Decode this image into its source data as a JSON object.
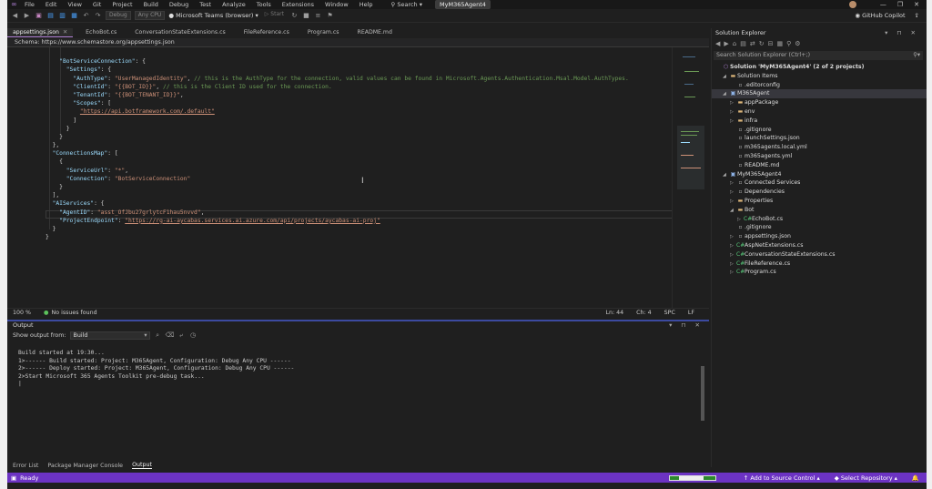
{
  "menu": {
    "items": [
      "File",
      "Edit",
      "View",
      "Git",
      "Project",
      "Build",
      "Debug",
      "Test",
      "Analyze",
      "Tools",
      "Extensions",
      "Window",
      "Help"
    ],
    "search": "Search",
    "solution_name": "MyM365Agent4"
  },
  "toolbar": {
    "config": "Debug",
    "platform": "Any CPU",
    "run_target": "Microsoft Teams (browser)",
    "start": "Start",
    "copilot": "GitHub Copilot"
  },
  "tabs": [
    {
      "label": "appsettings.json",
      "active": true
    },
    {
      "label": "EchoBot.cs",
      "active": false
    },
    {
      "label": "ConversationStateExtensions.cs",
      "active": false
    },
    {
      "label": "FileReference.cs",
      "active": false
    },
    {
      "label": "Program.cs",
      "active": false
    },
    {
      "label": "README.md",
      "active": false
    }
  ],
  "schema": "Schema: https://www.schemastore.org/appsettings.json",
  "code": {
    "l1_key": "\"BotServiceConnection\"",
    "l2_key": "\"Settings\"",
    "l3_key": "\"AuthType\"",
    "l3_val": "\"UserManagedIdentity\"",
    "l3_comment": "// this is the AuthType for the connection, valid values can be found in Microsoft.Agents.Authentication.Msal.Model.AuthTypes.",
    "l4_key": "\"ClientId\"",
    "l4_val": "\"{{BOT_ID}}\"",
    "l4_comment": "// this is the Client ID used for the connection.",
    "l5_key": "\"TenantId\"",
    "l5_val": "\"{{BOT_TENANT_ID}}\"",
    "l6_key": "\"Scopes\"",
    "l7_val": "\"https://api.botframework.com/.default\"",
    "l12_key": "\"ConnectionsMap\"",
    "l14_key": "\"ServiceUrl\"",
    "l14_val": "\"*\"",
    "l15_key": "\"Connection\"",
    "l15_val": "\"BotServiceConnection\"",
    "l18_key": "\"AIServices\"",
    "l19_key": "\"AgentID\"",
    "l19_val": "\"asst_OfJbu27grlytcF1hau5nvvd\"",
    "l20_key": "\"ProjectEndpoint\"",
    "l20_val": "\"https://rg-ai-aycabas.services.ai.azure.com/api/projects/aycabas-ai-proj\""
  },
  "editor_status": {
    "zoom": "100 %",
    "issues": "No issues found",
    "ln": "Ln: 44",
    "ch": "Ch: 4",
    "spc": "SPC",
    "lf": "LF"
  },
  "solution_explorer": {
    "title": "Solution Explorer",
    "search_placeholder": "Search Solution Explorer (Ctrl+;)",
    "nodes": [
      {
        "label": "Solution 'MyM365Agent4' (2 of 2 projects)",
        "level": 0,
        "icon": "sol",
        "arrow": "",
        "bold": true
      },
      {
        "label": "Solution Items",
        "level": 1,
        "icon": "folder",
        "arrow": "◢"
      },
      {
        "label": ".editorconfig",
        "level": 2,
        "icon": "file",
        "arrow": ""
      },
      {
        "label": "M365Agent",
        "level": 1,
        "icon": "proj",
        "arrow": "◢",
        "sel": true
      },
      {
        "label": "appPackage",
        "level": 2,
        "icon": "folder",
        "arrow": "▷"
      },
      {
        "label": "env",
        "level": 2,
        "icon": "folder",
        "arrow": "▷"
      },
      {
        "label": "infra",
        "level": 2,
        "icon": "folder",
        "arrow": "▷"
      },
      {
        "label": ".gitignore",
        "level": 2,
        "icon": "file",
        "arrow": ""
      },
      {
        "label": "launchSettings.json",
        "level": 2,
        "icon": "file",
        "arrow": ""
      },
      {
        "label": "m365agents.local.yml",
        "level": 2,
        "icon": "file",
        "arrow": ""
      },
      {
        "label": "m365agents.yml",
        "level": 2,
        "icon": "file",
        "arrow": ""
      },
      {
        "label": "README.md",
        "level": 2,
        "icon": "file",
        "arrow": ""
      },
      {
        "label": "MyM365Agent4",
        "level": 1,
        "icon": "proj",
        "arrow": "◢"
      },
      {
        "label": "Connected Services",
        "level": 2,
        "icon": "file",
        "arrow": "▷"
      },
      {
        "label": "Dependencies",
        "level": 2,
        "icon": "file",
        "arrow": "▷"
      },
      {
        "label": "Properties",
        "level": 2,
        "icon": "folder",
        "arrow": "▷"
      },
      {
        "label": "Bot",
        "level": 2,
        "icon": "folder",
        "arrow": "◢"
      },
      {
        "label": "EchoBot.cs",
        "level": 3,
        "icon": "cs",
        "arrow": "▷"
      },
      {
        "label": ".gitignore",
        "level": 2,
        "icon": "file",
        "arrow": ""
      },
      {
        "label": "appsettings.json",
        "level": 2,
        "icon": "file",
        "arrow": "▷"
      },
      {
        "label": "AspNetExtensions.cs",
        "level": 2,
        "icon": "cs",
        "arrow": "▷"
      },
      {
        "label": "ConversationStateExtensions.cs",
        "level": 2,
        "icon": "cs",
        "arrow": "▷"
      },
      {
        "label": "FileReference.cs",
        "level": 2,
        "icon": "cs",
        "arrow": "▷"
      },
      {
        "label": "Program.cs",
        "level": 2,
        "icon": "cs",
        "arrow": "▷"
      }
    ]
  },
  "output": {
    "title": "Output",
    "show_from_label": "Show output from:",
    "source": "Build",
    "lines": [
      "Build started at 19:30...",
      "1>------ Build started: Project: M365Agent, Configuration: Debug Any CPU ------",
      "2>------ Deploy started: Project: M365Agent, Configuration: Debug Any CPU ------",
      "2>Start Microsoft 365 Agents Toolkit pre-debug task..."
    ],
    "tabs": [
      "Error List",
      "Package Manager Console",
      "Output"
    ]
  },
  "status_bar": {
    "ready": "Ready",
    "source_control": "Add to Source Control",
    "repo": "Select Repository",
    "progress": 0.7
  }
}
